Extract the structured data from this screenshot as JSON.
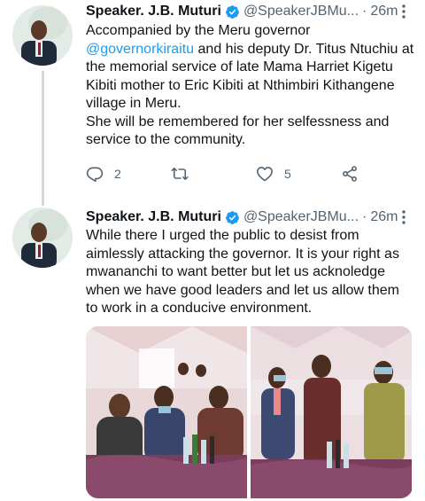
{
  "tweets": [
    {
      "name": "Speaker. J.B. Muturi",
      "handle": "@SpeakerJBMu...",
      "separator": "·",
      "time": "26m",
      "text_before_mention": "Accompanied by the Meru governor",
      "mention": "@governorkiraitu",
      "text_after_mention": " and his deputy Dr. Titus Ntuchiu at the memorial service of late Mama Harriet Kigetu Kibiti mother to Eric Kibiti at Nthimbiri Kithangene village in Meru.",
      "text_second_paragraph": "She will be remembered for her selfessness and service to the community.",
      "reply_count": "2",
      "retweet_count": "",
      "like_count": "5",
      "icons": {
        "reply": "reply-icon",
        "retweet": "retweet-icon",
        "like": "heart-icon",
        "share": "share-icon",
        "more": "more-icon",
        "verified": "verified-badge-icon"
      }
    },
    {
      "name": "Speaker. J.B. Muturi",
      "handle": "@SpeakerJBMu...",
      "separator": "·",
      "time": "26m",
      "text": "While there I urged the public to desist from aimlessly attacking the governor. It is your right as mwananchi to want better but let us acknoledge when we have good leaders and let us allow them to work in a conducive environment."
    }
  ],
  "colors": {
    "verified": "#1d9bf0",
    "mention": "#1d9bf0",
    "secondary_text": "#536471",
    "thread_line": "#cfd9de"
  }
}
